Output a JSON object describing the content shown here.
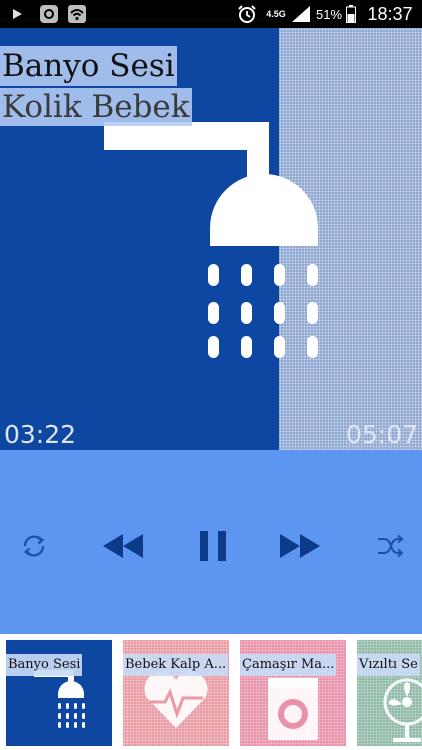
{
  "status_bar": {
    "network": "4.5G",
    "battery": "51%",
    "time": "18:37",
    "icons": [
      "play-icon",
      "chat-icon",
      "wifi-icon",
      "alarm-icon",
      "signal-icon",
      "battery-icon"
    ]
  },
  "now_playing": {
    "title": "Banyo Sesi",
    "subtitle": "Kolik Bebek",
    "artwork_icon": "shower-icon",
    "elapsed": "03:22",
    "duration": "05:07",
    "progress": 0.66
  },
  "controls": {
    "buttons": [
      "repeat-icon",
      "rewind-icon",
      "pause-icon",
      "fast-forward-icon",
      "shuffle-icon"
    ]
  },
  "playlist": {
    "items": [
      {
        "label": "Banyo Sesi",
        "icon": "shower-icon",
        "color": "#0d47a1"
      },
      {
        "label": "Bebek Kalp A...",
        "icon": "heart-pulse-icon",
        "color": "#e99aa3"
      },
      {
        "label": "Çamaşır Ma...",
        "icon": "washing-machine-icon",
        "color": "#e991a9"
      },
      {
        "label": "Vızıltı Se",
        "icon": "fan-icon",
        "color": "#8fb9a6"
      }
    ]
  },
  "colors": {
    "hero_bg": "#0d47a1",
    "controls_bg": "#5c96f0",
    "status_bg": "#000000"
  }
}
